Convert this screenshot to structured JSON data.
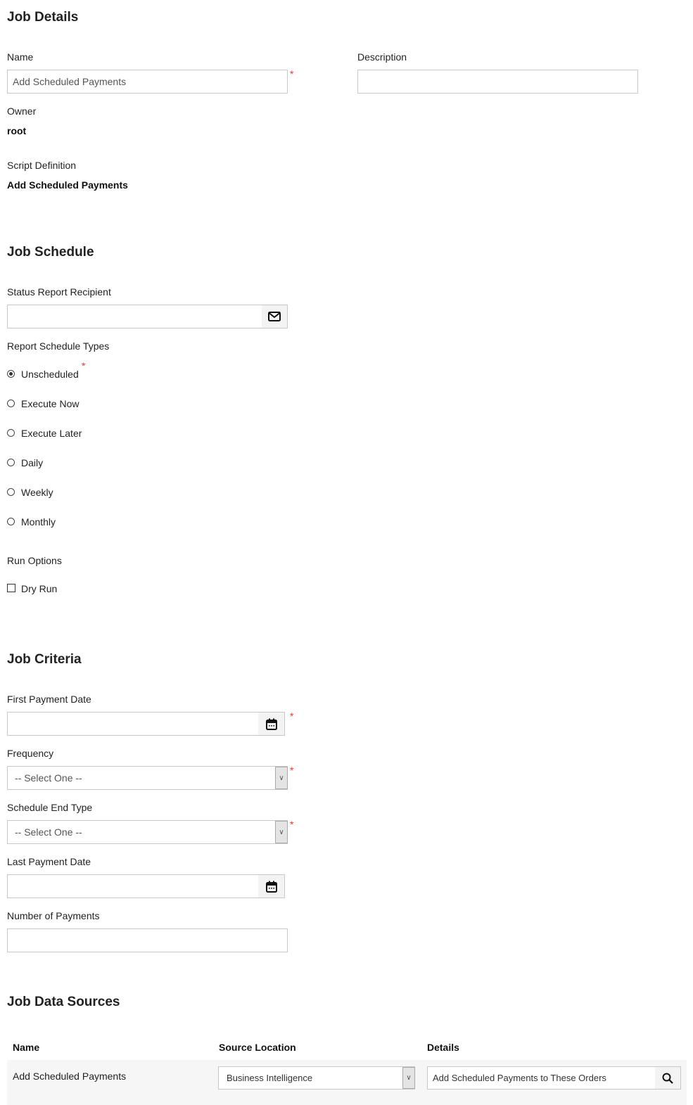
{
  "job_details": {
    "title": "Job Details",
    "name_label": "Name",
    "name_value": "Add Scheduled Payments",
    "description_label": "Description",
    "description_value": "",
    "owner_label": "Owner",
    "owner_value": "root",
    "script_label": "Script Definition",
    "script_value": "Add Scheduled Payments"
  },
  "job_schedule": {
    "title": "Job Schedule",
    "recipient_label": "Status Report Recipient",
    "recipient_value": "",
    "types_label": "Report Schedule Types",
    "types": [
      {
        "label": "Unscheduled",
        "selected": true
      },
      {
        "label": "Execute Now",
        "selected": false
      },
      {
        "label": "Execute Later",
        "selected": false
      },
      {
        "label": "Daily",
        "selected": false
      },
      {
        "label": "Weekly",
        "selected": false
      },
      {
        "label": "Monthly",
        "selected": false
      }
    ],
    "run_options_label": "Run Options",
    "dry_run_label": "Dry Run",
    "dry_run_checked": false
  },
  "job_criteria": {
    "title": "Job Criteria",
    "first_payment_label": "First Payment Date",
    "first_payment_value": "",
    "frequency_label": "Frequency",
    "frequency_value": "-- Select One --",
    "end_type_label": "Schedule End Type",
    "end_type_value": "-- Select One --",
    "last_payment_label": "Last Payment Date",
    "last_payment_value": "",
    "num_payments_label": "Number of Payments",
    "num_payments_value": ""
  },
  "job_data_sources": {
    "title": "Job Data Sources",
    "columns": [
      "Name",
      "Source Location",
      "Details"
    ],
    "rows": [
      {
        "name": "Add Scheduled Payments",
        "source_location": "Business Intelligence",
        "details": "Add Scheduled Payments to These Orders"
      }
    ]
  },
  "required_mark": "*"
}
